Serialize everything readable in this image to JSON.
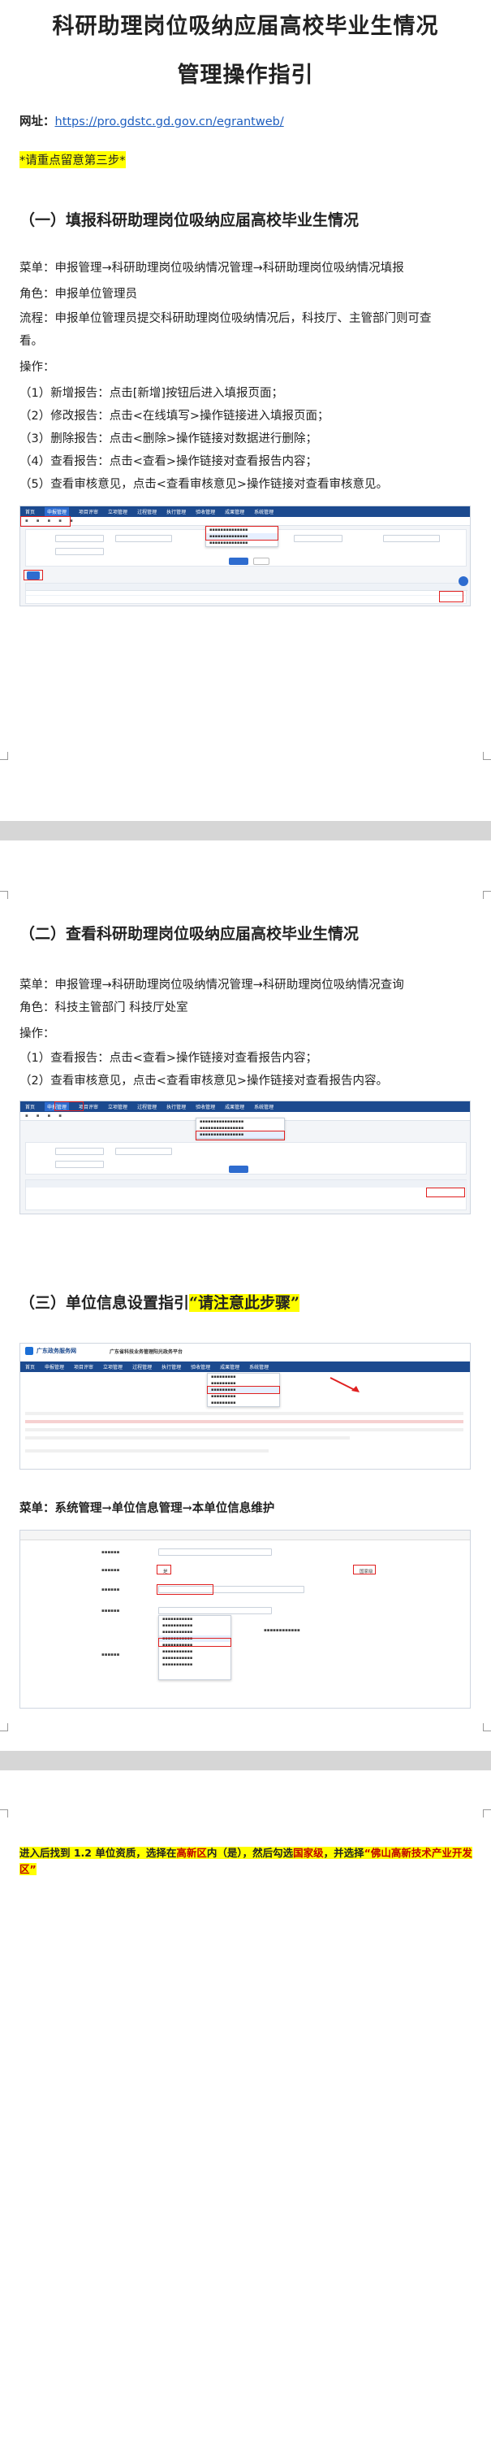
{
  "title_line1": "科研助理岗位吸纳应届高校毕业生情况",
  "title_line2": "管理操作指引",
  "url_label": "网址：",
  "url": "https://pro.gdstc.gd.gov.cn/egrantweb/",
  "note_step3": "*请重点留意第三步*",
  "section1": {
    "heading": "（一）填报科研助理岗位吸纳应届高校毕业生情况",
    "menu": "菜单：申报管理→科研助理岗位吸纳情况管理→科研助理岗位吸纳情况填报",
    "role": "角色：申报单位管理员",
    "flow_line1": "流程：申报单位管理员提交科研助理岗位吸纳情况后，科技厅、主管部门则可查",
    "flow_line2": "看。",
    "ops_label": "操作：",
    "ops": [
      "（1）新增报告：点击[新增]按钮后进入填报页面；",
      "（2）修改报告：点击<在线填写>操作链接进入填报页面；",
      "（3）删除报告：点击<删除>操作链接对数据进行删除；",
      "（4）查看报告：点击<查看>操作链接对查看报告内容；",
      "（5）查看审核意见，点击<查看审核意见>操作链接对查看审核意见。"
    ]
  },
  "section2": {
    "heading": "（二）查看科研助理岗位吸纳应届高校毕业生情况",
    "menu": "菜单：申报管理→科研助理岗位吸纳情况管理→科研助理岗位吸纳情况查询",
    "role": "角色：科技主管部门    科技厅处室",
    "ops_label": "操作：",
    "ops": [
      "（1）查看报告：点击<查看>操作链接对查看报告内容；",
      "（2）查看审核意见，点击<查看审核意见>操作链接对查看报告内容。"
    ]
  },
  "section3": {
    "heading": "（三）单位信息设置指引",
    "heading_hl": "“请注意此步骤”",
    "menu": "菜单：系统管理→单位信息管理→本单位信息维护",
    "final_note_p1": "进入后找到 1.2 单位资质，选择在",
    "final_note_b1": "高新区",
    "final_note_p2": "内（是），然后勾选",
    "final_note_b2": "国家级",
    "final_note_p3": "，并选择",
    "final_note_b3": "“佛山高新技术产业开发区”"
  },
  "mock": {
    "nav_items": [
      "首页",
      "申报管理",
      "项目评审",
      "立项管理",
      "过程管理",
      "执行管理",
      "验收管理",
      "成果管理",
      "系统管理"
    ],
    "portal_title": "广东政务服务网",
    "portal_sub": "广东省科技业务管理阳光政务平台",
    "search_btn": "查询",
    "add_btn": "新增",
    "unit_yes": "是",
    "unit_national": "国家级"
  },
  "colors": {
    "nav": "#1c4a8f",
    "accent": "#2e6ccf",
    "highlight": "#ffff00",
    "red": "#e02020"
  }
}
